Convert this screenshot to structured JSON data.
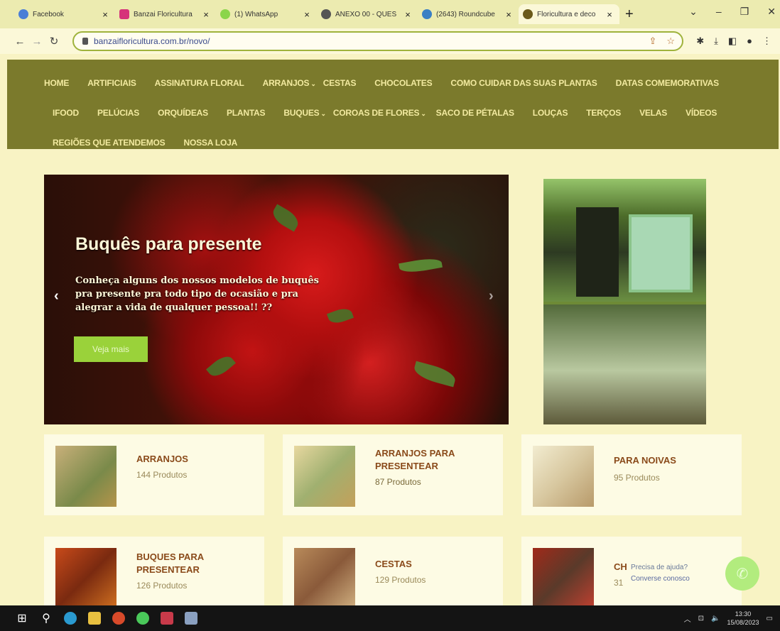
{
  "browser": {
    "tabs": [
      {
        "title": "Facebook",
        "color": "#4b7fd6"
      },
      {
        "title": "Banzai Floricultura",
        "color": "#d6337a"
      },
      {
        "title": "(1) WhatsApp",
        "color": "#8bd54a"
      },
      {
        "title": "ANEXO 00 - QUES",
        "color": "#555555"
      },
      {
        "title": "(2643) Roundcube",
        "color": "#3a7fc4"
      },
      {
        "title": "Floricultura e deco",
        "color": "#6b5a1a"
      }
    ],
    "active_tab_index": 5,
    "url": "banzaifloricultura.com.br/novo/"
  },
  "menu": {
    "row1": [
      {
        "label": "HOME"
      },
      {
        "label": "ARTIFICIAIS"
      },
      {
        "label": "ASSINATURA FLORAL"
      },
      {
        "label": "ARRANJOS",
        "dropdown": true
      },
      {
        "label": "CESTAS"
      },
      {
        "label": "CHOCOLATES"
      },
      {
        "label": "COMO CUIDAR DAS SUAS PLANTAS"
      },
      {
        "label": "DATAS COMEMORATIVAS"
      }
    ],
    "row2": [
      {
        "label": "IFOOD"
      },
      {
        "label": "PELÚCIAS"
      },
      {
        "label": "ORQUÍDEAS"
      },
      {
        "label": "PLANTAS"
      },
      {
        "label": "BUQUES",
        "dropdown": true
      },
      {
        "label": "COROAS DE FLORES",
        "dropdown": true
      },
      {
        "label": "SACO DE PÉTALAS"
      },
      {
        "label": "LOUÇAS"
      },
      {
        "label": "TERÇOS"
      },
      {
        "label": "VELAS"
      },
      {
        "label": "VÍDEOS"
      }
    ],
    "row3": [
      {
        "label": "REGIÕES QUE ATENDEMOS"
      },
      {
        "label": "NOSSA LOJA"
      }
    ]
  },
  "hero": {
    "title": "Buquês para presente",
    "text": "Conheça alguns dos nossos modelos de buquês pra presente pra todo tipo de ocasião e pra alegrar a vida de qualquer pessoa!! ??",
    "button": "Veja mais"
  },
  "categories": [
    {
      "title": "ARRANJOS",
      "count": "144 Produtos"
    },
    {
      "title": "ARRANJOS PARA PRESENTEAR",
      "count": "87 Produtos"
    },
    {
      "title": "PARA NOIVAS",
      "count": "95 Produtos"
    },
    {
      "title": "BUQUES PARA PRESENTEAR",
      "count": "126 Produtos"
    },
    {
      "title": "CESTAS",
      "count": "129 Produtos"
    },
    {
      "title": "CH",
      "count": "31"
    }
  ],
  "help": {
    "question": "Precisa de ajuda?",
    "action": "Converse conosco"
  },
  "taskbar": {
    "time": "13:30",
    "date": "15/08/2023"
  }
}
